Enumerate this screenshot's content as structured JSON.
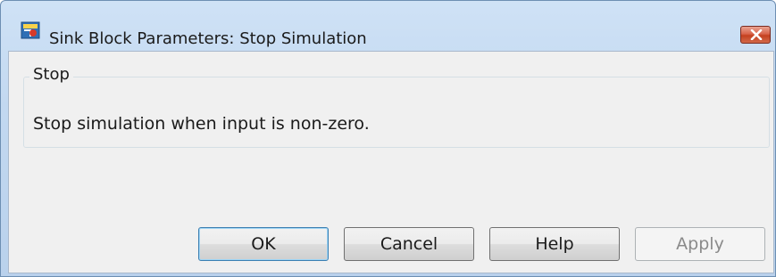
{
  "window": {
    "title": "Sink Block Parameters: Stop Simulation",
    "icon": "simulink-block-icon",
    "close_icon": "close-icon"
  },
  "group": {
    "title": "Stop",
    "description": "Stop simulation when input is non-zero."
  },
  "buttons": {
    "ok": "OK",
    "cancel": "Cancel",
    "help": "Help",
    "apply": "Apply"
  },
  "colors": {
    "close_button": "#c4401f",
    "window_frame": "#c2d8f0",
    "client_background": "#f0f0f0",
    "default_button_border": "#3c7fb1",
    "disabled_text": "#8a8a8a"
  },
  "states": {
    "apply_enabled": false,
    "ok_is_default": true
  }
}
